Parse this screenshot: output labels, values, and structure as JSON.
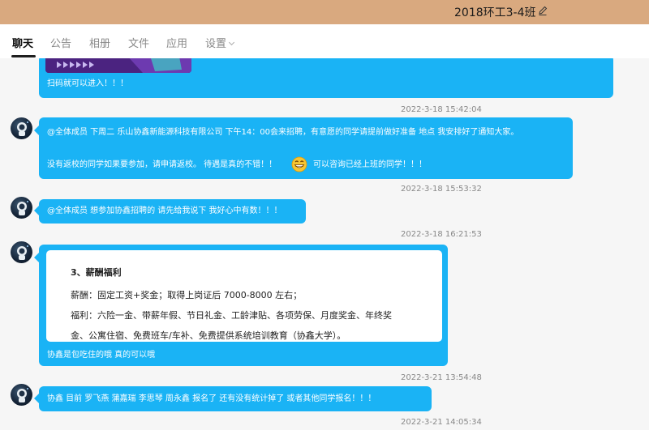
{
  "header": {
    "title": "2018环工3-4班"
  },
  "tabs": [
    {
      "label": "聊天"
    },
    {
      "label": "公告"
    },
    {
      "label": "相册"
    },
    {
      "label": "文件"
    },
    {
      "label": "应用"
    },
    {
      "label": "设置"
    }
  ],
  "messages": [
    {
      "lines": [
        "扫码就可以进入！！！"
      ]
    },
    {
      "timestamp": "2022-3-18 15:42:04",
      "lines": [
        "@全体成员 下周二   乐山协鑫新能源科技有限公司   下午14：00会来招聘，有意愿的同学请提前做好准备   地点 我安排好了通知大家。",
        "没有返校的同学如果要参加，请申请返校。 待遇是真的不错！！",
        "可以咨询已经上班的同学！！！"
      ]
    },
    {
      "timestamp": "2022-3-18 15:53:32",
      "lines": [
        "@全体成员 想参加协鑫招聘的  请先给我说下 我好心中有数！！！"
      ]
    },
    {
      "timestamp": "2022-3-18 16:21:53",
      "card": {
        "title": "3、薪酬福利",
        "lines": [
          "薪酬：固定工资+奖金；取得上岗证后 7000-8000 左右；",
          "福利：六险一金、带薪年假、节日礼金、工龄津贴、各项劳保、月度奖金、年终奖",
          "金、公寓住宿、免费班车/车补、免费提供系统培训教育（协鑫大学）。"
        ]
      },
      "lines": [
        "协鑫是包吃住的哦 真的可以哦"
      ]
    },
    {
      "timestamp": "2022-3-21 13:54:48",
      "lines": [
        "协鑫  目前 罗飞燕   蒲嘉瑞   李思琴   周永鑫 报名了    还有没有统计掉了  或者其他同学报名！！！"
      ]
    },
    {
      "timestamp": "2022-3-21 14:05:34"
    }
  ],
  "colors": {
    "bubble": "#1ab3f5",
    "titlebar": "#d9a97f"
  }
}
